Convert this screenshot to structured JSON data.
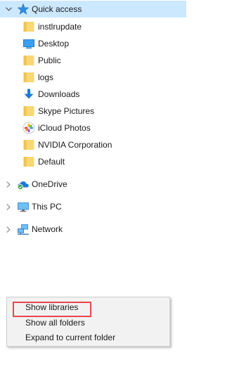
{
  "tree": {
    "quick_access": "Quick access",
    "pinned": [
      {
        "label": "instlrupdate",
        "icon": "folder-icon"
      },
      {
        "label": "Desktop",
        "icon": "desktop-icon"
      },
      {
        "label": "Public",
        "icon": "folder-icon"
      },
      {
        "label": "logs",
        "icon": "folder-icon"
      },
      {
        "label": "Downloads",
        "icon": "download-arrow-icon"
      },
      {
        "label": "Skype Pictures",
        "icon": "folder-icon"
      },
      {
        "label": "iCloud Photos",
        "icon": "icloud-photos-icon"
      },
      {
        "label": "NVIDIA Corporation",
        "icon": "folder-icon"
      },
      {
        "label": "Default",
        "icon": "folder-icon"
      }
    ],
    "onedrive": "OneDrive",
    "this_pc": "This PC",
    "network": "Network"
  },
  "context_menu": {
    "items": [
      "Show libraries",
      "Show all folders",
      "Expand to current folder"
    ],
    "highlighted": "Show libraries"
  },
  "colors": {
    "selection": "#cce8ff",
    "folder": "#f8d775",
    "accent_blue": "#1e78d7",
    "callout": "#e8474f"
  }
}
